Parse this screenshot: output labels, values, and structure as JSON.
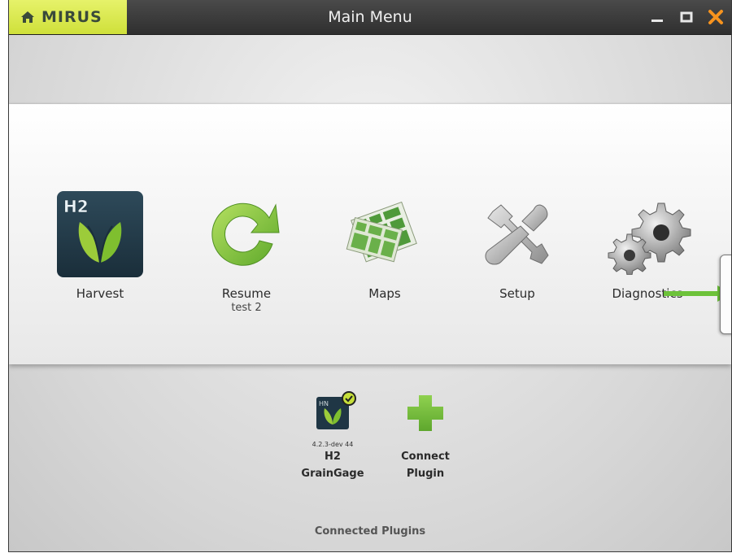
{
  "titlebar": {
    "brand": "MIRUS",
    "title": "Main Menu",
    "colors": {
      "home_accent": "#d9e84a",
      "close": "#f7931e",
      "bar": "#3a3a3a"
    }
  },
  "menu": {
    "harvest": {
      "label": "Harvest",
      "badge": "H2",
      "icon": "harvest-leaf-icon"
    },
    "resume": {
      "label": "Resume",
      "sublabel": "test 2",
      "icon": "resume-arrow-icon"
    },
    "maps": {
      "label": "Maps",
      "icon": "maps-icon"
    },
    "setup": {
      "label": "Setup",
      "icon": "setup-tools-icon"
    },
    "diagnostics": {
      "label": "Diagnostics",
      "icon": "gears-icon"
    }
  },
  "plugins": {
    "caption": "Connected Plugins",
    "items": [
      {
        "line1": "H2",
        "line2": "GrainGage",
        "version": "4.2.3-dev 44",
        "badge": "HN",
        "status": "connected"
      },
      {
        "line1": "Connect",
        "line2": "Plugin",
        "icon": "plus-icon"
      }
    ]
  },
  "accent_green": "#7cc242"
}
